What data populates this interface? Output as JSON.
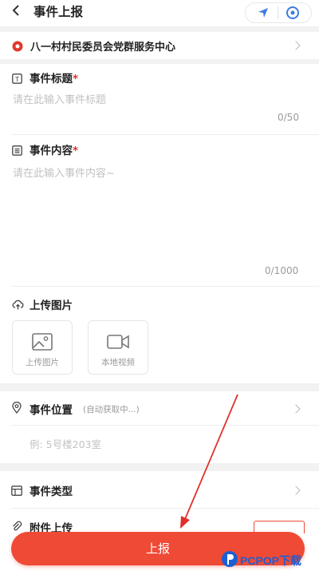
{
  "header": {
    "title": "事件上报",
    "back_icon": "chevron-left-icon",
    "location_icon": "location-arrow-icon",
    "target_icon": "target-icon"
  },
  "org": {
    "name": "八一村村民委员会党群服务中心"
  },
  "title_field": {
    "label": "事件标题",
    "required_mark": "*",
    "placeholder": "请在此输入事件标题",
    "counter": "0/50"
  },
  "content_field": {
    "label": "事件内容",
    "required_mark": "*",
    "placeholder": "请在此输入事件内容~",
    "counter": "0/1000"
  },
  "upload": {
    "label": "上传图片",
    "image_button": "上传图片",
    "video_button": "本地视频"
  },
  "location": {
    "label": "事件位置",
    "status": "(自动获取中...)",
    "placeholder": "例: 5号楼203室"
  },
  "event_type": {
    "label": "事件类型"
  },
  "attachment": {
    "label": "附件上传"
  },
  "submit": {
    "label": "上报"
  },
  "watermark": {
    "text": "PCPOP下载"
  },
  "colors": {
    "accent": "#ef4a36",
    "link_blue": "#3d7be0",
    "annotation": "#e0302a"
  }
}
